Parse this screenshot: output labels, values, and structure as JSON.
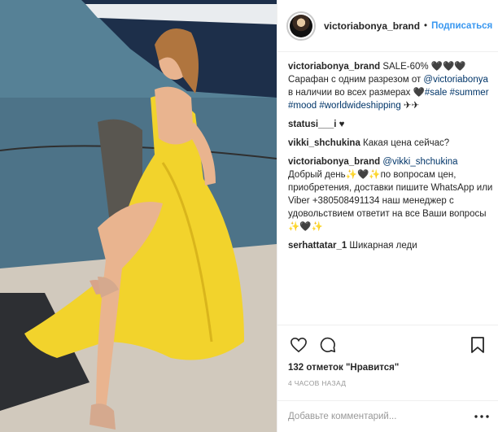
{
  "header": {
    "username": "victoriabonya_brand",
    "dot": "•",
    "follow_label": "Подписаться"
  },
  "caption": {
    "username": "victoriabonya_brand",
    "text_1": "SALE-60% 🖤🖤🖤 Сарафан с одним разрезом от ",
    "mention": "@victoriabonya",
    "text_2": " в наличии во всех размерах 🖤",
    "tags": "#sale #summer #mood #worldwideshipping",
    "text_3": " ✈✈"
  },
  "comments": [
    {
      "username": "statusi___i",
      "text": " ♥"
    },
    {
      "username": "vikki_shchukina",
      "text": " Какая цена сейчас?"
    }
  ],
  "reply": {
    "username": "victoriabonya_brand",
    "mention": "@vikki_shchukina",
    "text": " Добрый день✨🖤✨по вопросам цен, приобретения, доставки пишите WhatsApp или Viber +380508491134 наш менеджер с удовольствием ответит на все Ваши вопросы ✨🖤✨"
  },
  "last_comment": {
    "username": "serhattatar_1",
    "text": " Шикарная леди"
  },
  "likes": "132 отметок \"Нравится\"",
  "time": "4 часов назад",
  "add_comment_placeholder": "Добавьте комментарий...",
  "icons": [
    "heart-icon",
    "comment-icon",
    "bookmark-icon",
    "more-options-icon"
  ],
  "colors": {
    "link": "#003569",
    "follow": "#3897f0",
    "dress": "#f2d32c"
  }
}
